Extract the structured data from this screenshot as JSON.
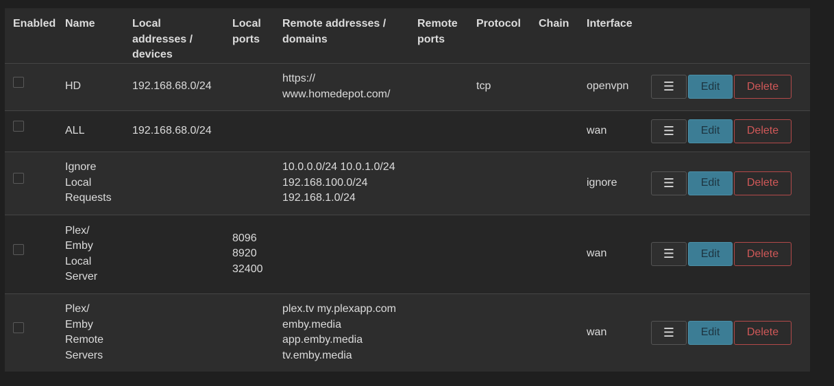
{
  "columns": {
    "enabled": "Enabled",
    "name": "Name",
    "local": "Local addresses / devices",
    "local_ports": "Local ports",
    "remote": "Remote addresses / domains",
    "remote_ports": "Remote ports",
    "protocol": "Protocol",
    "chain": "Chain",
    "interface": "Interface"
  },
  "buttons": {
    "menu": "☰",
    "edit": "Edit",
    "delete": "Delete"
  },
  "rows": [
    {
      "enabled": false,
      "name": "HD",
      "local": "192.168.68.0/24",
      "local_ports": "",
      "remote": "https:// www.homedepot.com/",
      "remote_ports": "",
      "protocol": "tcp",
      "chain": "",
      "interface": "openvpn"
    },
    {
      "enabled": false,
      "name": "ALL",
      "local": "192.168.68.0/24",
      "local_ports": "",
      "remote": "",
      "remote_ports": "",
      "protocol": "",
      "chain": "",
      "interface": "wan"
    },
    {
      "enabled": false,
      "name": "Ignore Local Requests",
      "local": "",
      "local_ports": "",
      "remote": "10.0.0.0/24 10.0.1.0/24 192.168.100.0/24 192.168.1.0/24",
      "remote_ports": "",
      "protocol": "",
      "chain": "",
      "interface": "ignore"
    },
    {
      "enabled": false,
      "name": "Plex/ Emby Local Server",
      "local": "",
      "local_ports": "8096 8920 32400",
      "remote": "",
      "remote_ports": "",
      "protocol": "",
      "chain": "",
      "interface": "wan"
    },
    {
      "enabled": false,
      "name": "Plex/ Emby Remote Servers",
      "local": "",
      "local_ports": "",
      "remote": "plex.tv my.plexapp.com emby.media app.emby.media tv.emby.media",
      "remote_ports": "",
      "protocol": "",
      "chain": "",
      "interface": "wan"
    }
  ]
}
